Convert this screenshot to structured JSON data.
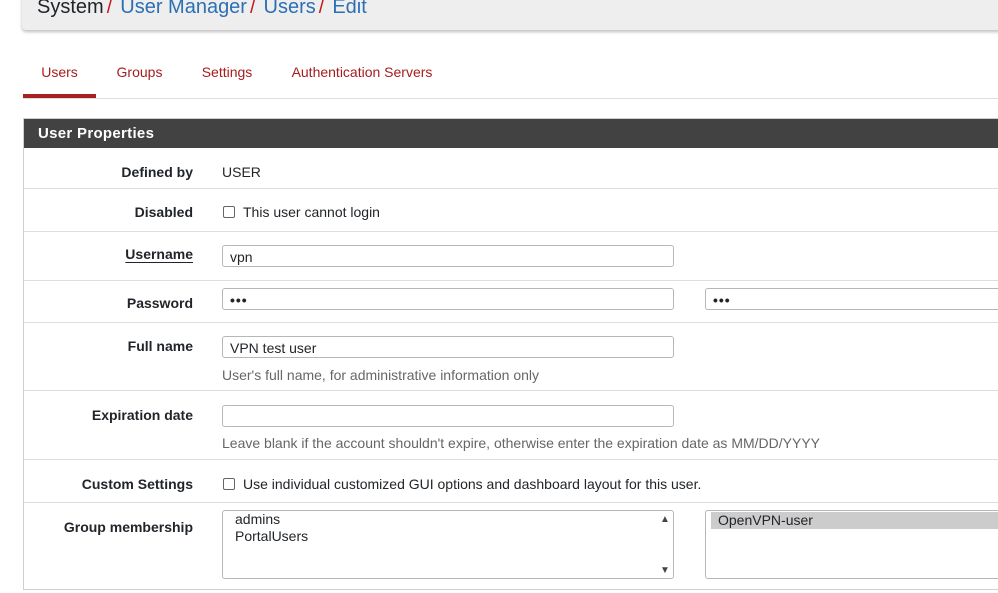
{
  "breadcrumb": {
    "items": [
      "System",
      "User Manager",
      "Users",
      "Edit"
    ],
    "separator": "/"
  },
  "tabs": [
    {
      "label": "Users",
      "active": true
    },
    {
      "label": "Groups",
      "active": false
    },
    {
      "label": "Settings",
      "active": false
    },
    {
      "label": "Authentication Servers",
      "active": false
    }
  ],
  "panel": {
    "title": "User Properties"
  },
  "form": {
    "defined_by": {
      "label": "Defined by",
      "value": "USER"
    },
    "disabled": {
      "label": "Disabled",
      "checkbox_label": "This user cannot login",
      "checked": false
    },
    "username": {
      "label": "Username",
      "value": "vpn"
    },
    "password": {
      "label": "Password",
      "value_masked": "•••",
      "confirm_masked": "•••"
    },
    "full_name": {
      "label": "Full name",
      "value": "VPN test user",
      "help": "User's full name, for administrative information only"
    },
    "expiration": {
      "label": "Expiration date",
      "value": "",
      "help": "Leave blank if the account shouldn't expire, otherwise enter the expiration date as MM/DD/YYYY"
    },
    "custom_settings": {
      "label": "Custom Settings",
      "checkbox_label": "Use individual customized GUI options and dashboard layout for this user.",
      "checked": false
    },
    "group_membership": {
      "label": "Group membership",
      "available": [
        "admins",
        "PortalUsers"
      ],
      "member_of": [
        "OpenVPN-user"
      ]
    }
  },
  "colors": {
    "accent_red": "#a82121",
    "link_blue": "#2c6fb3",
    "panel_header": "#424242"
  }
}
